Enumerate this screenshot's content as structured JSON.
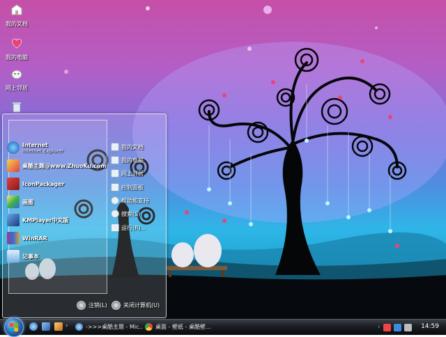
{
  "desktop": {
    "icons": [
      {
        "label": "我的文档",
        "icon": "documents-icon"
      },
      {
        "label": "我的电脑",
        "icon": "computer-icon"
      },
      {
        "label": "网上邻居",
        "icon": "network-icon"
      },
      {
        "label": "",
        "icon": "recycle-bin-icon"
      }
    ]
  },
  "start_menu": {
    "left_items": [
      {
        "label": "Internet",
        "sub": "Internet Explorer"
      },
      {
        "label": "桌酷主题@www.ZhuoKu.com",
        "sub": ""
      },
      {
        "label": "IconPackager",
        "sub": ""
      },
      {
        "label": "画图",
        "sub": ""
      },
      {
        "label": "KMPlayer中文版",
        "sub": ""
      },
      {
        "label": "WinRAR",
        "sub": ""
      },
      {
        "label": "记事本",
        "sub": ""
      }
    ],
    "right_items": [
      {
        "label": "我的文档"
      },
      {
        "label": "我的电脑"
      },
      {
        "label": "网上邻居"
      },
      {
        "label": "控制面板"
      },
      {
        "label": "帮助和支持"
      },
      {
        "label": "搜索(S)"
      },
      {
        "label": "运行(R)..."
      }
    ],
    "logoff_label": "注销(L)",
    "shutdown_label": "关闭计算机(U)"
  },
  "taskbar": {
    "tasks": [
      {
        "label": "->>>桌酷主题 - Mic..."
      },
      {
        "label": "桌面 - 壁纸 - 桌酷壁..."
      }
    ],
    "clock": "14:59"
  },
  "colors": {
    "sky_top": "#c64fa8",
    "sky_mid": "#4f8de0",
    "ground": "#080d12",
    "heart": "#e8447a"
  }
}
